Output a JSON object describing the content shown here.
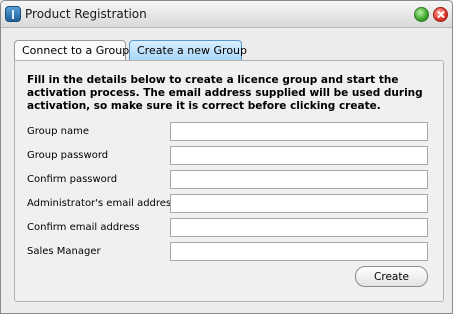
{
  "window": {
    "title": "Product Registration"
  },
  "tabs": [
    {
      "label": "Connect to a Group",
      "active": false
    },
    {
      "label": "Create a new Group",
      "active": true
    }
  ],
  "form": {
    "intro": "Fill in the details below to create a licence group and start the activation process. The email address supplied will be used during activation, so make sure it is correct before clicking create.",
    "fields": [
      {
        "label": "Group name",
        "value": ""
      },
      {
        "label": "Group password",
        "value": ""
      },
      {
        "label": "Confirm password",
        "value": ""
      },
      {
        "label": "Administrator's email address",
        "value": ""
      },
      {
        "label": "Confirm email address",
        "value": ""
      },
      {
        "label": "Sales Manager",
        "value": ""
      }
    ],
    "submit_label": "Create"
  },
  "colors": {
    "active_tab": "#a8d6f8",
    "window_bg": "#ececec"
  }
}
